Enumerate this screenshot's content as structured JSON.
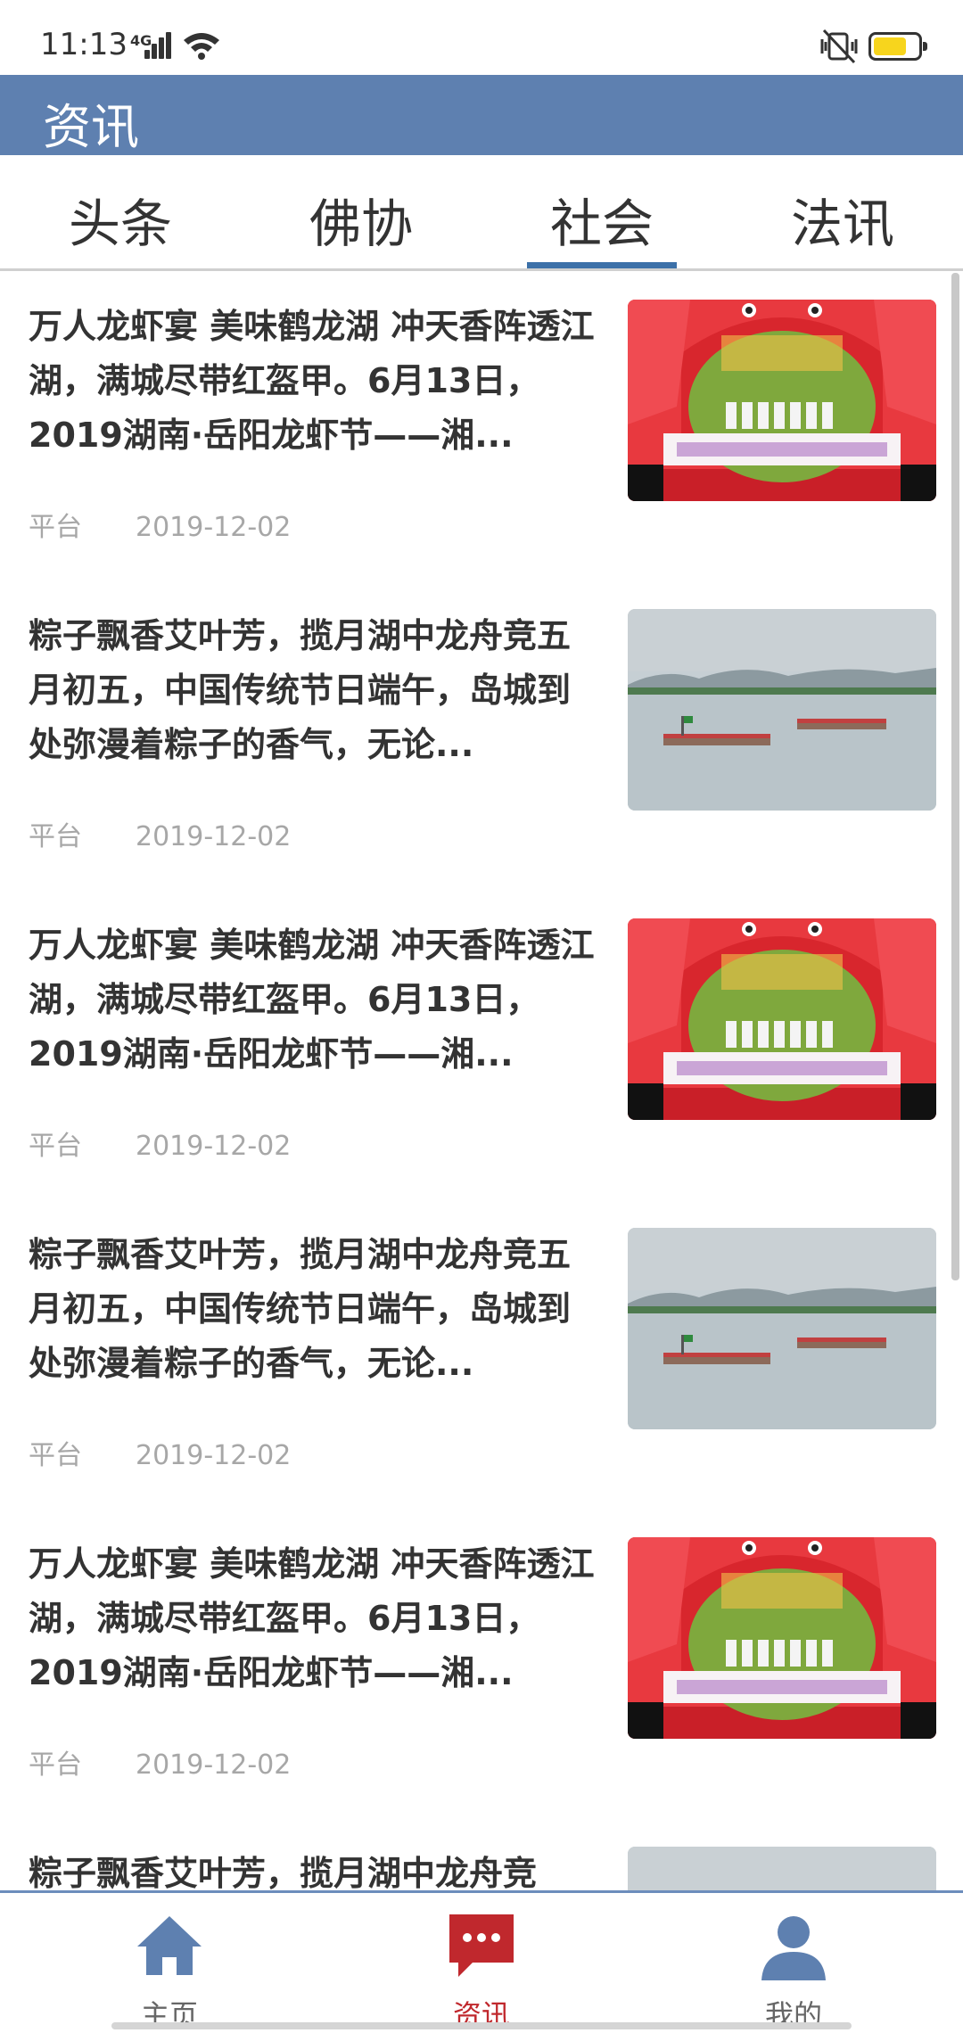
{
  "status_bar": {
    "time": "11:13",
    "network": "4G"
  },
  "header": {
    "title": "资讯"
  },
  "tabs": [
    {
      "label": "头条",
      "active": false
    },
    {
      "label": "佛协",
      "active": false
    },
    {
      "label": "社会",
      "active": true
    },
    {
      "label": "法讯",
      "active": false
    }
  ],
  "articles": [
    {
      "title": "万人龙虾宴 美味鹤龙湖 冲天香阵透江湖，满城尽带红盔甲。6月13日，2019湖南·岳阳龙虾节——湘...",
      "source": "平台",
      "date": "2019-12-02",
      "image": "lobster-festival-stage-image"
    },
    {
      "title": "粽子飘香艾叶芳，揽月湖中龙舟竞五月初五，中国传统节日端午，岛城到处弥漫着粽子的香气，无论...",
      "source": "平台",
      "date": "2019-12-02",
      "image": "dragon-boat-race-image"
    },
    {
      "title": "万人龙虾宴 美味鹤龙湖 冲天香阵透江湖，满城尽带红盔甲。6月13日，2019湖南·岳阳龙虾节——湘...",
      "source": "平台",
      "date": "2019-12-02",
      "image": "lobster-festival-stage-image"
    },
    {
      "title": "粽子飘香艾叶芳，揽月湖中龙舟竞五月初五，中国传统节日端午，岛城到处弥漫着粽子的香气，无论...",
      "source": "平台",
      "date": "2019-12-02",
      "image": "dragon-boat-race-image"
    },
    {
      "title": "万人龙虾宴 美味鹤龙湖 冲天香阵透江湖，满城尽带红盔甲。6月13日，2019湖南·岳阳龙虾节——湘...",
      "source": "平台",
      "date": "2019-12-02",
      "image": "lobster-festival-stage-image"
    },
    {
      "title": "粽子飘香艾叶芳，揽月湖中龙舟竞",
      "source": "",
      "date": "",
      "image": "dragon-boat-race-image"
    }
  ],
  "bottom_nav": [
    {
      "label": "主页",
      "icon": "home-icon",
      "active": false
    },
    {
      "label": "资讯",
      "icon": "message-icon",
      "active": true
    },
    {
      "label": "我的",
      "icon": "user-icon",
      "active": false
    }
  ],
  "colors": {
    "header_bg": "#5e80b0",
    "tab_indicator": "#3c70a8",
    "active_nav": "#c0282d",
    "inactive_nav_icon": "#5e80b0",
    "meta_text": "#a7a7a7"
  }
}
